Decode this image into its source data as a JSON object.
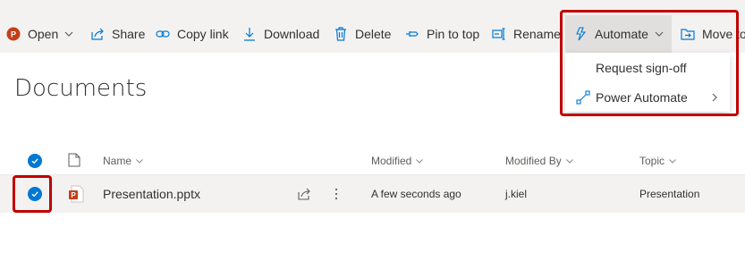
{
  "commandbar": {
    "open": "Open",
    "share": "Share",
    "copy_link": "Copy link",
    "download": "Download",
    "delete": "Delete",
    "pin_to_top": "Pin to top",
    "rename": "Rename",
    "automate": "Automate",
    "move_to": "Move to"
  },
  "automate_menu": {
    "items": [
      {
        "label": "Request sign-off",
        "icon": "none"
      },
      {
        "label": "Power Automate",
        "icon": "flow-icon",
        "has_submenu": true
      }
    ]
  },
  "library": {
    "title": "Documents"
  },
  "columns": {
    "name": "Name",
    "modified": "Modified",
    "modified_by": "Modified By",
    "topic": "Topic"
  },
  "rows": [
    {
      "selected": true,
      "file_type": "pptx",
      "name": "Presentation.pptx",
      "modified": "A few seconds ago",
      "modified_by": "j.kiel",
      "topic": "Presentation"
    }
  ],
  "colors": {
    "accent": "#0078d4",
    "highlight_box": "#c00000",
    "powerpoint": "#c43e1c",
    "commandbar_bg": "#f3f2f1"
  }
}
